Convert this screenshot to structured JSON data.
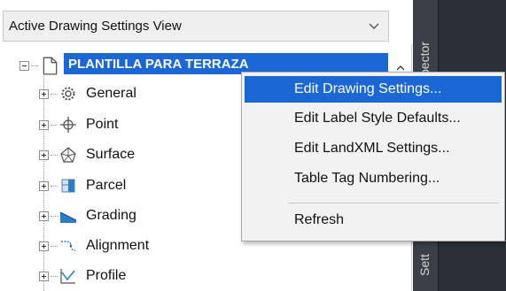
{
  "view_selector": {
    "value": "Active Drawing Settings View"
  },
  "side_tabs": {
    "top": "pector",
    "bottom": "Sett"
  },
  "tree": {
    "root": {
      "label": "PLANTILLA PARA TERRAZA"
    },
    "items": [
      {
        "label": "General",
        "icon": "gear-icon"
      },
      {
        "label": "Point",
        "icon": "point-icon"
      },
      {
        "label": "Surface",
        "icon": "surface-icon"
      },
      {
        "label": "Parcel",
        "icon": "parcel-icon"
      },
      {
        "label": "Grading",
        "icon": "grading-icon"
      },
      {
        "label": "Alignment",
        "icon": "alignment-icon"
      },
      {
        "label": "Profile",
        "icon": "profile-icon"
      }
    ]
  },
  "context_menu": {
    "items": [
      {
        "label": "Edit Drawing Settings...",
        "highlighted": true
      },
      {
        "label": "Edit Label Style Defaults..."
      },
      {
        "label": "Edit LandXML Settings..."
      },
      {
        "label": "Table Tag Numbering..."
      },
      {
        "label": "Refresh"
      }
    ]
  },
  "colors": {
    "selection": "#1b67d6",
    "dark_panel": "#2b2f38",
    "menu_bg": "#f2f2f2"
  }
}
